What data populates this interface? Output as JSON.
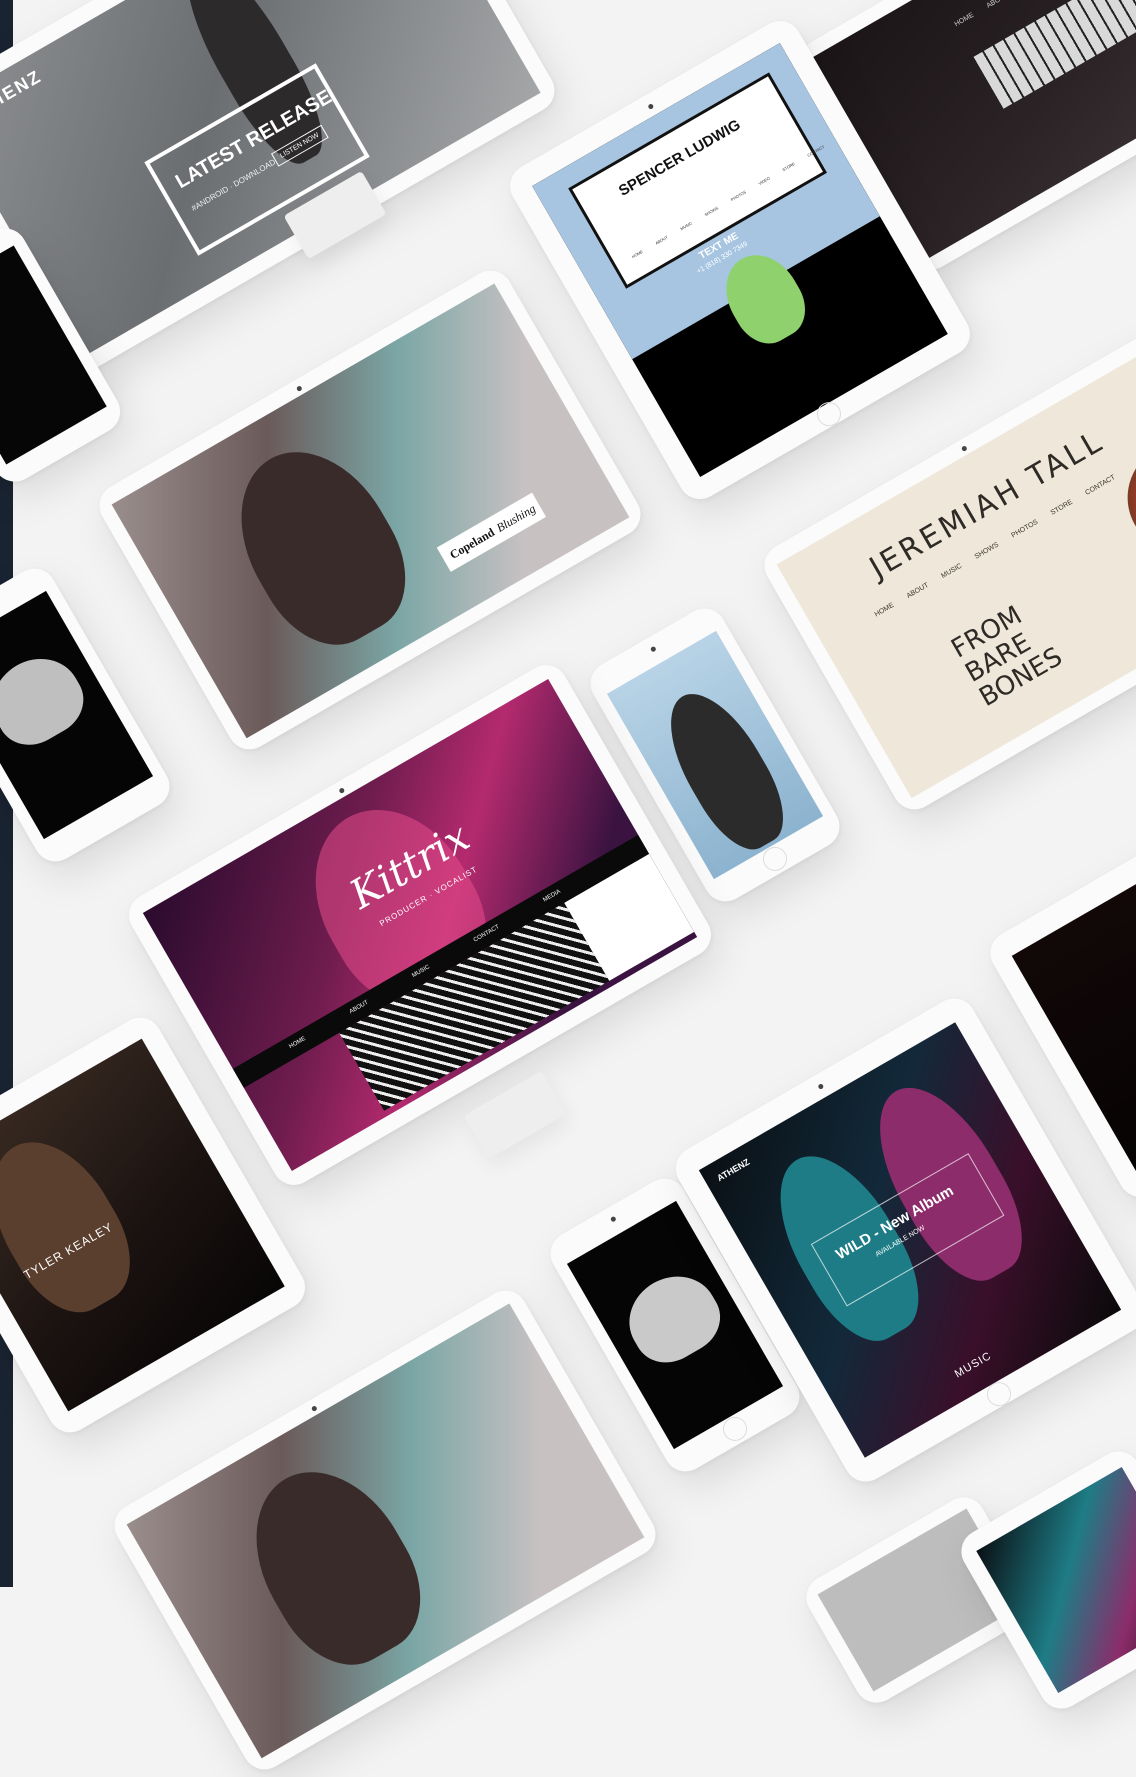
{
  "sites": {
    "athenz": {
      "logo": "ATHENZ",
      "headline": "LATEST RELEASE",
      "sub": "#ANDROID · DOWNLOAD",
      "cta": "LISTEN NOW"
    },
    "spencer": {
      "name": "SPENCER LUDWIG",
      "line1": "TEXT ME",
      "line2": "+1 (818) 330 7349",
      "nav": [
        "HOME",
        "ABOUT",
        "MUSIC",
        "SHOWS",
        "PHOTOS",
        "VIDEO",
        "STORE",
        "CONTACT"
      ]
    },
    "topright": {
      "nav": [
        "HOME",
        "ABOUT"
      ]
    },
    "copeland": {
      "title": "Copeland",
      "title_italic": "Blushing"
    },
    "jeremiah": {
      "name": "JEREMIAH TALL",
      "nav": [
        "HOME",
        "ABOUT",
        "MUSIC",
        "SHOWS",
        "PHOTOS",
        "STORE",
        "CONTACT"
      ],
      "album": "FROM BARE BONES"
    },
    "kittrix": {
      "logo": "Kittrix",
      "tagline": "PRODUCER · VOCALIST",
      "nav": [
        "HOME",
        "ABOUT",
        "MUSIC",
        "CONTACT",
        "MEDIA"
      ]
    },
    "tyler": {
      "name": "TYLER KEALEY"
    },
    "wild": {
      "logo": "ATHENZ",
      "headline": "WILD - New Album",
      "sub": "AVAILABLE NOW",
      "section": "MUSIC"
    }
  },
  "colors": {
    "background": "#f3f3f4",
    "device": "#fbfbfb",
    "edge": "#1a2331"
  }
}
